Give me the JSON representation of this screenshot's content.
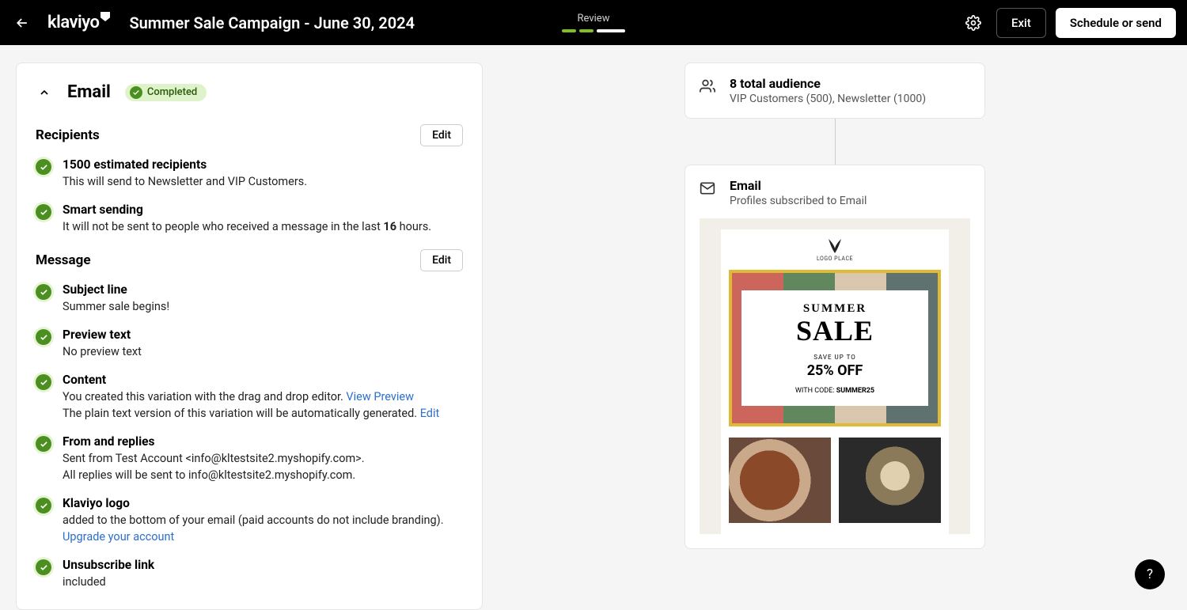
{
  "header": {
    "campaignTitle": "Summer Sale Campaign - June 30, 2024",
    "stepLabel": "Review",
    "exit": "Exit",
    "schedule": "Schedule or send"
  },
  "left": {
    "emailHeading": "Email",
    "completedBadge": "Completed",
    "sections": {
      "recipients": {
        "title": "Recipients",
        "edit": "Edit",
        "estimated": {
          "title": "1500 estimated recipients",
          "desc": "This will send to Newsletter and VIP Customers."
        },
        "smart": {
          "title": "Smart sending",
          "descPrefix": "It will not be sent to people who received a message in the last ",
          "hours": "16",
          "descSuffix": " hours."
        }
      },
      "message": {
        "title": "Message",
        "edit": "Edit",
        "subject": {
          "title": "Subject line",
          "desc": "Summer sale begins!"
        },
        "preview": {
          "title": "Preview text",
          "desc": "No preview text"
        },
        "content": {
          "title": "Content",
          "desc1": "You created this variation with the drag and drop editor. ",
          "viewPreview": "View Preview",
          "desc2": "The plain text version of this variation will be automatically generated. ",
          "editLink": "Edit"
        },
        "from": {
          "title": "From and replies",
          "line1": "Sent from Test Account <info@kltestsite2.myshopify.com>.",
          "line2": "All replies will be sent to info@kltestsite2.myshopify.com."
        },
        "logo": {
          "title": "Klaviyo logo",
          "desc": "added to the bottom of your email (paid accounts do not include branding). ",
          "upgrade": "Upgrade your account"
        },
        "unsub": {
          "title": "Unsubscribe link",
          "desc": "included"
        }
      }
    }
  },
  "right": {
    "audience": {
      "title": "8 total audience",
      "sub": "VIP Customers (500), Newsletter (1000)"
    },
    "emailNode": {
      "title": "Email",
      "sub": "Profiles subscribed to Email"
    },
    "preview": {
      "logoPlace": "LOGO PLACE",
      "summer": "SUMMER",
      "sale": "SALE",
      "saveUp": "SAVE UP TO",
      "pct": "25% OFF",
      "withCode": "WITH CODE: ",
      "code": "SUMMER25"
    }
  },
  "help": "?"
}
